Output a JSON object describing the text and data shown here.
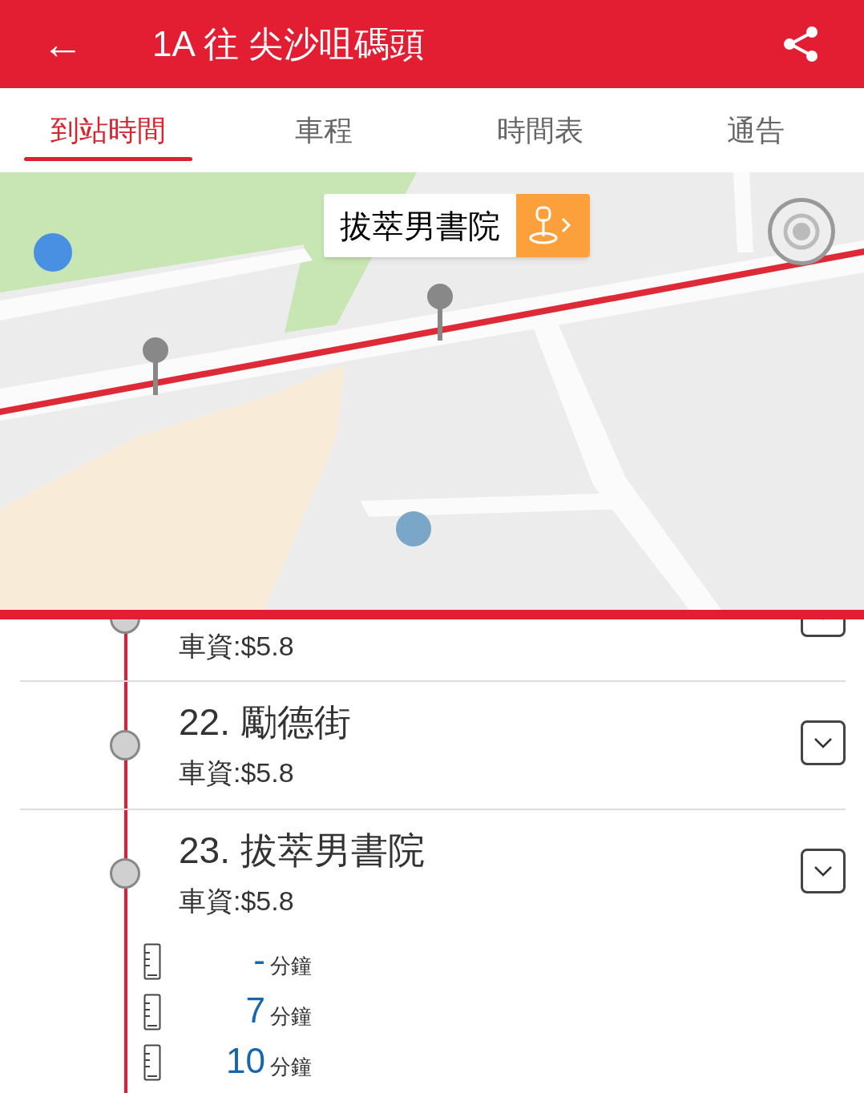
{
  "app_bar": {
    "back_icon": "←",
    "title": "1A 往 尖沙咀碼頭"
  },
  "tabs": [
    {
      "label": "到站時間",
      "selected": true
    },
    {
      "label": "車程",
      "selected": false
    },
    {
      "label": "時間表",
      "selected": false
    },
    {
      "label": "通告",
      "selected": false
    }
  ],
  "map": {
    "callout": {
      "title": "拔萃男書院"
    }
  },
  "stops": [
    {
      "fare": "車資:$5.8"
    },
    {
      "name": "22. 勵德街",
      "fare": "車資:$5.8"
    },
    {
      "name": "23. 拔萃男書院",
      "fare": "車資:$5.8",
      "etas": [
        {
          "value": "-",
          "unit": "分鐘"
        },
        {
          "value": "7",
          "unit": "分鐘"
        },
        {
          "value": "10",
          "unit": "分鐘"
        }
      ]
    }
  ]
}
